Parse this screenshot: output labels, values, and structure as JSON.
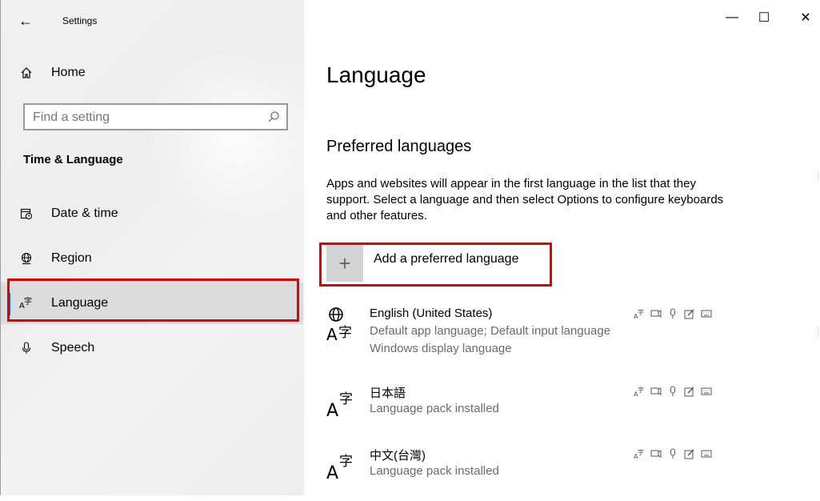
{
  "window": {
    "title": "Settings",
    "controls": {
      "minimize": "—",
      "maximize": "☐",
      "close": "✕"
    }
  },
  "sidebar": {
    "home_label": "Home",
    "search_placeholder": "Find a setting",
    "section_heading": "Time & Language",
    "items": [
      {
        "label": "Date & time",
        "icon": "calendar-clock-icon",
        "selected": false
      },
      {
        "label": "Region",
        "icon": "globe-region-icon",
        "selected": false
      },
      {
        "label": "Language",
        "icon": "language-icon",
        "selected": true
      },
      {
        "label": "Speech",
        "icon": "microphone-icon",
        "selected": false
      }
    ]
  },
  "main": {
    "title": "Language",
    "preferred_heading": "Preferred languages",
    "description": "Apps and websites will appear in the first language in the list that they support. Select a language and then select Options to configure keyboards and other features.",
    "add_button_label": "Add a preferred language",
    "add_button_symbol": "+",
    "languages": [
      {
        "name": "English (United States)",
        "line2": "Default app language; Default input language",
        "line3": "Windows display language",
        "icon": "globe-language-icon"
      },
      {
        "name": "日本語",
        "line2": "Language pack installed",
        "line3": "",
        "icon": "language-icon"
      },
      {
        "name": "中文(台灣)",
        "line2": "Language pack installed",
        "line3": "",
        "icon": "language-icon"
      }
    ],
    "feature_icons": [
      "display-language-icon",
      "text-to-speech-icon",
      "speech-icon",
      "handwriting-icon",
      "keyboard-icon"
    ]
  },
  "colors": {
    "accent": "#0078d7",
    "highlight": "#e30000",
    "sidebar_bg": "#f0f0f0",
    "selected_bg": "#dcdcdc",
    "secondary_text": "#6b6b6b"
  }
}
